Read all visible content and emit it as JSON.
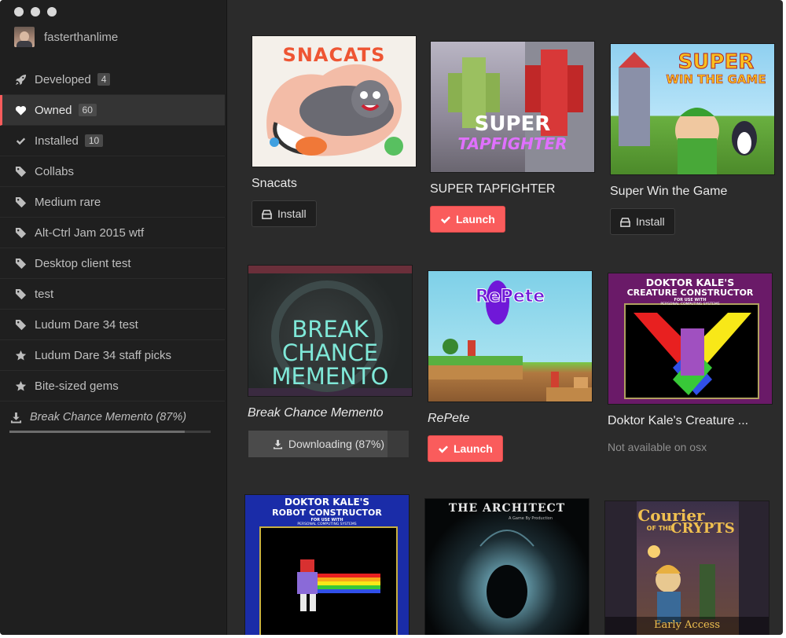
{
  "user": {
    "name": "fasterthanlime"
  },
  "sidebar": {
    "items": [
      {
        "label": "Developed",
        "badge": "4",
        "icon": "rocket-icon"
      },
      {
        "label": "Owned",
        "badge": "60",
        "icon": "heart-icon",
        "active": true
      },
      {
        "label": "Installed",
        "badge": "10",
        "icon": "checkmark-icon"
      },
      {
        "label": "Collabs",
        "icon": "tag-icon"
      },
      {
        "label": "Medium rare",
        "icon": "tag-icon"
      },
      {
        "label": "Alt-Ctrl Jam 2015 wtf",
        "icon": "tag-icon"
      },
      {
        "label": "Desktop client test",
        "icon": "tag-icon"
      },
      {
        "label": "test",
        "icon": "tag-icon"
      },
      {
        "label": "Ludum Dare 34 test",
        "icon": "tag-icon"
      },
      {
        "label": "Ludum Dare 34 staff picks",
        "icon": "star-icon"
      },
      {
        "label": "Bite-sized gems",
        "icon": "star-icon"
      }
    ],
    "download": {
      "label": "Break Chance Memento (87%)",
      "progress": 0.87,
      "icon": "download-icon"
    }
  },
  "games": [
    {
      "title": "Snacats",
      "cover_text": "SNACATS",
      "action": "Install",
      "action_type": "install"
    },
    {
      "title": "SUPER TAPFIGHTER",
      "cover_text_1": "SUPER",
      "cover_text_2": "TAPFIGHTER",
      "action": "Launch",
      "action_type": "launch"
    },
    {
      "title": "Super Win the Game",
      "cover_text_1": "SUPER",
      "cover_text_2": "WIN THE GAME",
      "action": "Install",
      "action_type": "install"
    },
    {
      "title": "Break Chance Memento",
      "cover_text_1": "BREAK",
      "cover_text_2": "CHANCE",
      "cover_text_3": "MEMENTO",
      "action": "Downloading (87%)",
      "action_type": "downloading",
      "progress": 0.87
    },
    {
      "title": "RePete",
      "cover_text": "RePete",
      "action": "Launch",
      "action_type": "launch"
    },
    {
      "title": "Doktor Kale's Creature ...",
      "cover_text_1": "DOKTOR KALE'S",
      "cover_text_2": "CREATURE CONSTRUCTOR",
      "cover_text_3": "FOR USE WITH",
      "cover_text_4": "PERSONAL COMPUTING SYSTEMS",
      "action": "Not available on osx",
      "action_type": "unavailable"
    },
    {
      "cover_text_1": "DOKTOR KALE'S",
      "cover_text_2": "ROBOT CONSTRUCTOR",
      "cover_text_3": "FOR USE WITH",
      "cover_text_4": "PERSONAL COMPUTING SYSTEMS"
    },
    {
      "cover_text_1": "THE ARCHITECT",
      "cover_text_2": "A Game By Production"
    },
    {
      "cover_text_1": "Courier",
      "cover_text_2": "OF THE",
      "cover_text_3": "CRYPTS",
      "cover_text_4": "Early Access"
    }
  ],
  "colors": {
    "accent": "#fa5c5c",
    "sidebar_bg": "#1f1f1f",
    "main_bg": "#2b2b2b"
  }
}
